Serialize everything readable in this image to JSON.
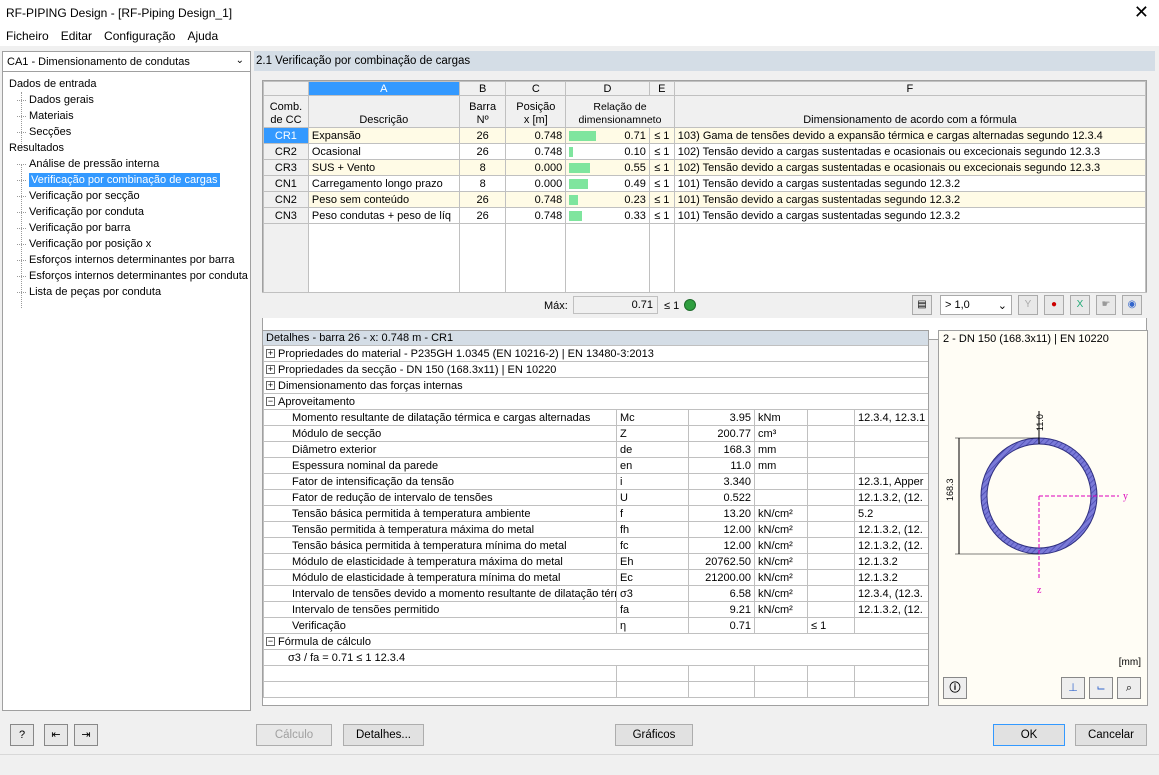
{
  "window": {
    "title": "RF-PIPING Design - [RF-Piping Design_1]",
    "close": "✕"
  },
  "menu": [
    "Ficheiro",
    "Editar",
    "Configuração",
    "Ajuda"
  ],
  "sidebar": {
    "combo": "CA1 - Dimensionamento de condutas",
    "input_header": "Dados de entrada",
    "input_items": [
      "Dados gerais",
      "Materiais",
      "Secções"
    ],
    "results_header": "Resultados",
    "result_items": [
      "Análise de pressão interna",
      "Verificação por combinação de cargas",
      "Verificação por secção",
      "Verificação por conduta",
      "Verificação por barra",
      "Verificação por posição x",
      "Esforços internos determinantes por barra",
      "Esforços internos determinantes por conduta",
      "Lista de peças por conduta"
    ],
    "selected_index": 1
  },
  "main": {
    "header": "2.1 Verificação por combinação de cargas",
    "col_letters": [
      "A",
      "B",
      "C",
      "D",
      "E",
      "F"
    ],
    "col_headers": {
      "comb": "Comb.\nde CC",
      "desc": "Descrição",
      "barra": "Barra\nNº",
      "pos": "Posição\nx [m]",
      "ratio": "Relação de\ndimensionamneto",
      "formula": "Dimensionamento de acordo com a fórmula"
    },
    "rows": [
      {
        "cc": "CR1",
        "desc": "Expansão",
        "barra": "26",
        "pos": "0.748",
        "ratio": 0.71,
        "ratio_text": "0.71",
        "le": "≤ 1",
        "formula": "103) Gama de tensões devido a expansão térmica e cargas alternadas segundo 12.3.4"
      },
      {
        "cc": "CR2",
        "desc": "Ocasional",
        "barra": "26",
        "pos": "0.748",
        "ratio": 0.1,
        "ratio_text": "0.10",
        "le": "≤ 1",
        "formula": "102) Tensão devido a cargas sustentadas e ocasionais ou excecionais segundo 12.3.3"
      },
      {
        "cc": "CR3",
        "desc": "SUS + Vento",
        "barra": "8",
        "pos": "0.000",
        "ratio": 0.55,
        "ratio_text": "0.55",
        "le": "≤ 1",
        "formula": "102) Tensão devido a cargas sustentadas e ocasionais ou excecionais segundo 12.3.3"
      },
      {
        "cc": "CN1",
        "desc": "Carregamento longo prazo",
        "barra": "8",
        "pos": "0.000",
        "ratio": 0.49,
        "ratio_text": "0.49",
        "le": "≤ 1",
        "formula": "101) Tensão devido a cargas sustentadas segundo 12.3.2"
      },
      {
        "cc": "CN2",
        "desc": "Peso sem conteúdo",
        "barra": "26",
        "pos": "0.748",
        "ratio": 0.23,
        "ratio_text": "0.23",
        "le": "≤ 1",
        "formula": "101) Tensão devido a cargas sustentadas segundo 12.3.2"
      },
      {
        "cc": "CN3",
        "desc": "Peso condutas + peso de líq",
        "barra": "26",
        "pos": "0.748",
        "ratio": 0.33,
        "ratio_text": "0.33",
        "le": "≤ 1",
        "formula": "101) Tensão devido a cargas sustentadas segundo 12.3.2"
      }
    ],
    "max_label": "Máx:",
    "max_value": "0.71",
    "max_le": "≤ 1",
    "filter_combo": "> 1,0"
  },
  "details": {
    "title": "Detalhes - barra 26 - x: 0.748 m - CR1",
    "groups": [
      "Propriedades do material - P235GH 1.0345 (EN 10216-2) | EN 13480-3:2013",
      "Propriedades da secção - DN 150 (168.3x11) | EN 10220",
      "Dimensionamento das forças internas",
      "Aproveitamento"
    ],
    "rows": [
      {
        "name": "Momento resultante de dilatação térmica e cargas alternadas",
        "sym": "Mc",
        "val": "3.95",
        "unit": "kNm",
        "le": "",
        "ref": "12.3.4, 12.3.1"
      },
      {
        "name": "Módulo de secção",
        "sym": "Z",
        "val": "200.77",
        "unit": "cm³",
        "le": "",
        "ref": ""
      },
      {
        "name": "Diâmetro exterior",
        "sym": "de",
        "val": "168.3",
        "unit": "mm",
        "le": "",
        "ref": ""
      },
      {
        "name": "Espessura nominal da parede",
        "sym": "en",
        "val": "11.0",
        "unit": "mm",
        "le": "",
        "ref": ""
      },
      {
        "name": "Fator de intensificação da tensão",
        "sym": "i",
        "val": "3.340",
        "unit": "",
        "le": "",
        "ref": "12.3.1, Apper"
      },
      {
        "name": "Fator de redução de intervalo de tensões",
        "sym": "U",
        "val": "0.522",
        "unit": "",
        "le": "",
        "ref": "12.1.3.2, (12."
      },
      {
        "name": "Tensão básica permitida à temperatura ambiente",
        "sym": "f",
        "val": "13.20",
        "unit": "kN/cm²",
        "le": "",
        "ref": "5.2"
      },
      {
        "name": "Tensão permitida à temperatura máxima do metal",
        "sym": "fh",
        "val": "12.00",
        "unit": "kN/cm²",
        "le": "",
        "ref": "12.1.3.2, (12."
      },
      {
        "name": "Tensão básica permitida à temperatura mínima do metal",
        "sym": "fc",
        "val": "12.00",
        "unit": "kN/cm²",
        "le": "",
        "ref": "12.1.3.2, (12."
      },
      {
        "name": "Módulo de elasticidade à temperatura máxima do metal",
        "sym": "Eh",
        "val": "20762.50",
        "unit": "kN/cm²",
        "le": "",
        "ref": "12.1.3.2"
      },
      {
        "name": "Módulo de elasticidade à temperatura mínima do metal",
        "sym": "Ec",
        "val": "21200.00",
        "unit": "kN/cm²",
        "le": "",
        "ref": "12.1.3.2"
      },
      {
        "name": "Intervalo de tensões devido a momento resultante de dilatação térmi",
        "sym": "σ3",
        "val": "6.58",
        "unit": "kN/cm²",
        "le": "",
        "ref": "12.3.4, (12.3."
      },
      {
        "name": "Intervalo de tensões permitido",
        "sym": "fa",
        "val": "9.21",
        "unit": "kN/cm²",
        "le": "",
        "ref": "12.1.3.2, (12."
      },
      {
        "name": "Verificação",
        "sym": "η",
        "val": "0.71",
        "unit": "",
        "le": "≤ 1",
        "ref": ""
      }
    ],
    "formula_group": "Fórmula de cálculo",
    "formula": "σ3 / fa = 0.71 ≤ 1   12.3.4"
  },
  "graph": {
    "title": "2 - DN 150 (168.3x11) | EN 10220",
    "dim_t": "11.0",
    "dim_d": "168.3",
    "axis_y": "y",
    "axis_z": "z",
    "unit": "[mm]"
  },
  "buttons": {
    "calc": "Cálculo",
    "details": "Detalhes...",
    "graphics": "Gráficos",
    "ok": "OK",
    "cancel": "Cancelar"
  }
}
